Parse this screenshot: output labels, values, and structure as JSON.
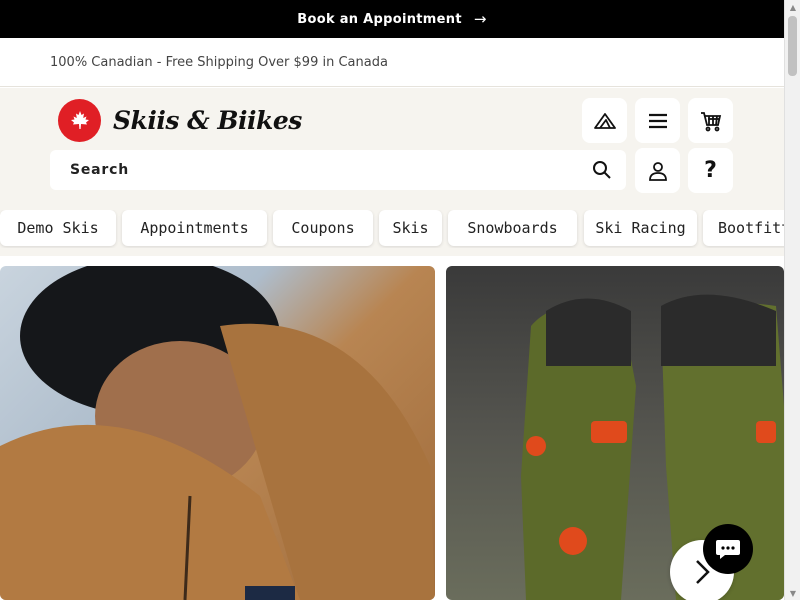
{
  "top_banner": {
    "label": "Book an Appointment",
    "arrow": "→"
  },
  "announcement": {
    "text": "100% Canadian - Free Shipping Over $99 in Canada"
  },
  "logo": {
    "text": "Skiis & Biikes",
    "brand_color": "#e01f25"
  },
  "header_icons": [
    "mountain-icon",
    "menu-icon",
    "cart-icon",
    "user-icon",
    "help-icon"
  ],
  "help": {
    "label": "?"
  },
  "search": {
    "placeholder": "Search"
  },
  "categories": [
    "Demo Skis",
    "Appointments",
    "Coupons",
    "Skis",
    "Snowboards",
    "Ski Racing",
    "Bootfitting"
  ],
  "colors": {
    "banner_bg": "#000000",
    "header_bg": "#f6f4ef",
    "accent": "#e01f25"
  }
}
